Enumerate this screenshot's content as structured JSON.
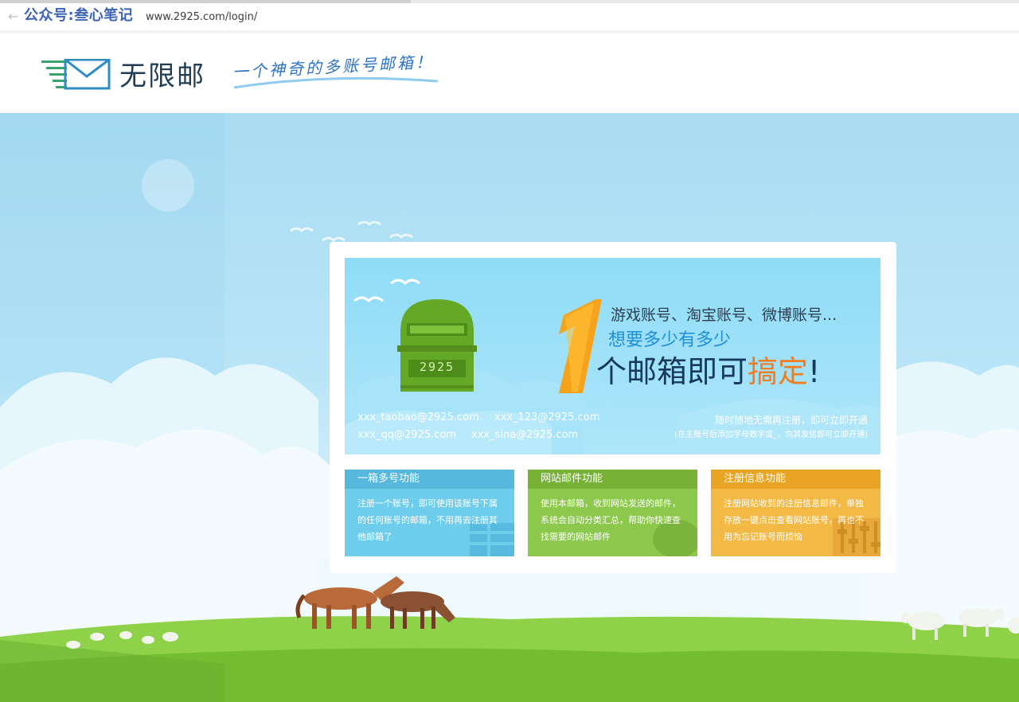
{
  "browser": {
    "back_glyph": "←",
    "watermark": "公众号:叁心笔记",
    "url": "www.2925.com/login/"
  },
  "header": {
    "logo_text": "无限邮",
    "slogan": "一个神奇的多账号邮箱！"
  },
  "banner": {
    "mailbox_number": "2925",
    "line1": "游戏账号、淘宝账号、微博账号...",
    "line2": "想要多少有多少",
    "line3_prefix": "个邮箱即可",
    "line3_highlight": "搞定",
    "line3_suffix": "!",
    "emails": [
      "xxx_taobao@2925.com",
      "xxx_123@2925.com",
      "xxx_qq@2925.com",
      "xxx_sina@2925.com"
    ],
    "note_main": "随时随地无需再注册，即可立即开通",
    "note_sub": "(在主账号后添加字母数字或_，向其发信即可立即开通)"
  },
  "features": [
    {
      "title": "一箱多号功能",
      "desc": "注册一个账号，即可使用该账号下属的任何账号的邮箱，不用再去注册其他邮箱了",
      "color": "#6ecdeb"
    },
    {
      "title": "网站邮件功能",
      "desc": "使用本邮箱，收到网站发送的邮件，系统会自动分类汇总，帮助你快速查找需要的网站邮件",
      "color": "#8cc84b"
    },
    {
      "title": "注册信息功能",
      "desc": "注册网站收到的注册信息邮件，单独存放一键点击查看网站账号，再也不用为忘记账号而烦恼",
      "color": "#f2b945"
    }
  ],
  "colors": {
    "sky": "#a9dcf2",
    "grass": "#7cc43a",
    "accent_orange": "#f07d20",
    "brand_dark": "#1f3d55"
  }
}
